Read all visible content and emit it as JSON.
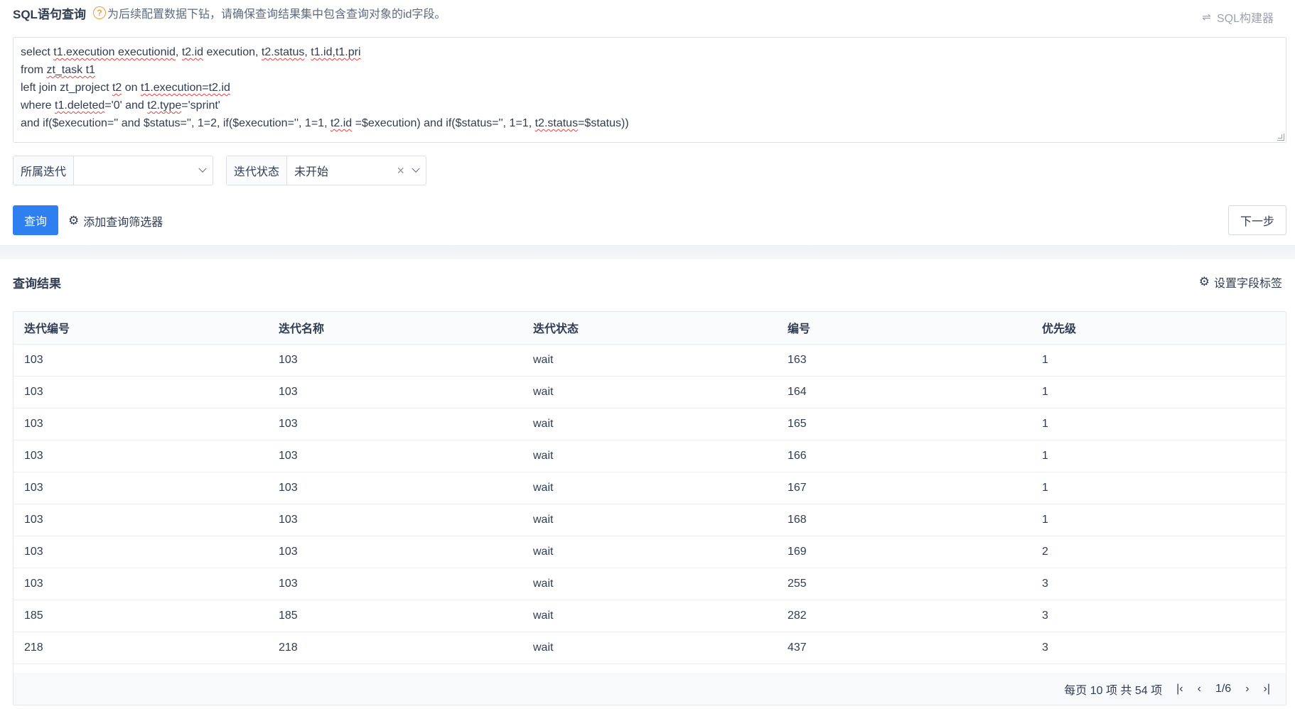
{
  "header": {
    "title": "SQL语句查询",
    "help_icon_glyph": "?",
    "hint": "为后续配置数据下钻，请确保查询结果集中包含查询对象的id字段。",
    "sql_builder_label": "SQL构建器",
    "sql_builder_icon": "⇌"
  },
  "sql": {
    "line1_a": "select ",
    "line1_b": "t1.execution executionid",
    "line1_c": ", ",
    "line1_d": "t2.id",
    "line1_e": " execution, ",
    "line1_f": "t2.status",
    "line1_g": ", ",
    "line1_h": "t1.id,t1.pri",
    "line2_a": "from ",
    "line2_b": "zt_task t1",
    "line3_a": "left join zt_project ",
    "line3_b": "t2",
    "line3_c": " on ",
    "line3_d": "t1.execution=t2.id",
    "line4_a": "where ",
    "line4_b": "t1.deleted",
    "line4_c": "='0' and ",
    "line4_d": "t2.type",
    "line4_e": "='sprint'",
    "line5_a": "and if($execution='' and $status='', 1=2, if($execution='', 1=1, ",
    "line5_b": "t2.id",
    "line5_c": " =$execution) and if($status='', 1=1, ",
    "line5_d": "t2.status",
    "line5_e": "=$status))"
  },
  "filters": {
    "iteration_label": "所属迭代",
    "iteration_value": "",
    "status_label": "迭代状态",
    "status_value": "未开始",
    "clear_glyph": "×"
  },
  "actions": {
    "query_label": "查询",
    "add_filter_label": "添加查询筛选器",
    "gear_icon": "⚙",
    "next_label": "下一步"
  },
  "results": {
    "title": "查询结果",
    "field_labels_label": "设置字段标签",
    "columns": [
      "迭代编号",
      "迭代名称",
      "迭代状态",
      "编号",
      "优先级"
    ],
    "rows": [
      [
        "103",
        "103",
        "wait",
        "163",
        "1"
      ],
      [
        "103",
        "103",
        "wait",
        "164",
        "1"
      ],
      [
        "103",
        "103",
        "wait",
        "165",
        "1"
      ],
      [
        "103",
        "103",
        "wait",
        "166",
        "1"
      ],
      [
        "103",
        "103",
        "wait",
        "167",
        "1"
      ],
      [
        "103",
        "103",
        "wait",
        "168",
        "1"
      ],
      [
        "103",
        "103",
        "wait",
        "169",
        "2"
      ],
      [
        "103",
        "103",
        "wait",
        "255",
        "3"
      ],
      [
        "185",
        "185",
        "wait",
        "282",
        "3"
      ],
      [
        "218",
        "218",
        "wait",
        "437",
        "3"
      ]
    ]
  },
  "pager": {
    "summary": "每页 10 项 共 54 项",
    "page": "1/6",
    "first_glyph": "|‹",
    "prev_glyph": "‹",
    "next_glyph": "›",
    "last_glyph": "›|"
  }
}
